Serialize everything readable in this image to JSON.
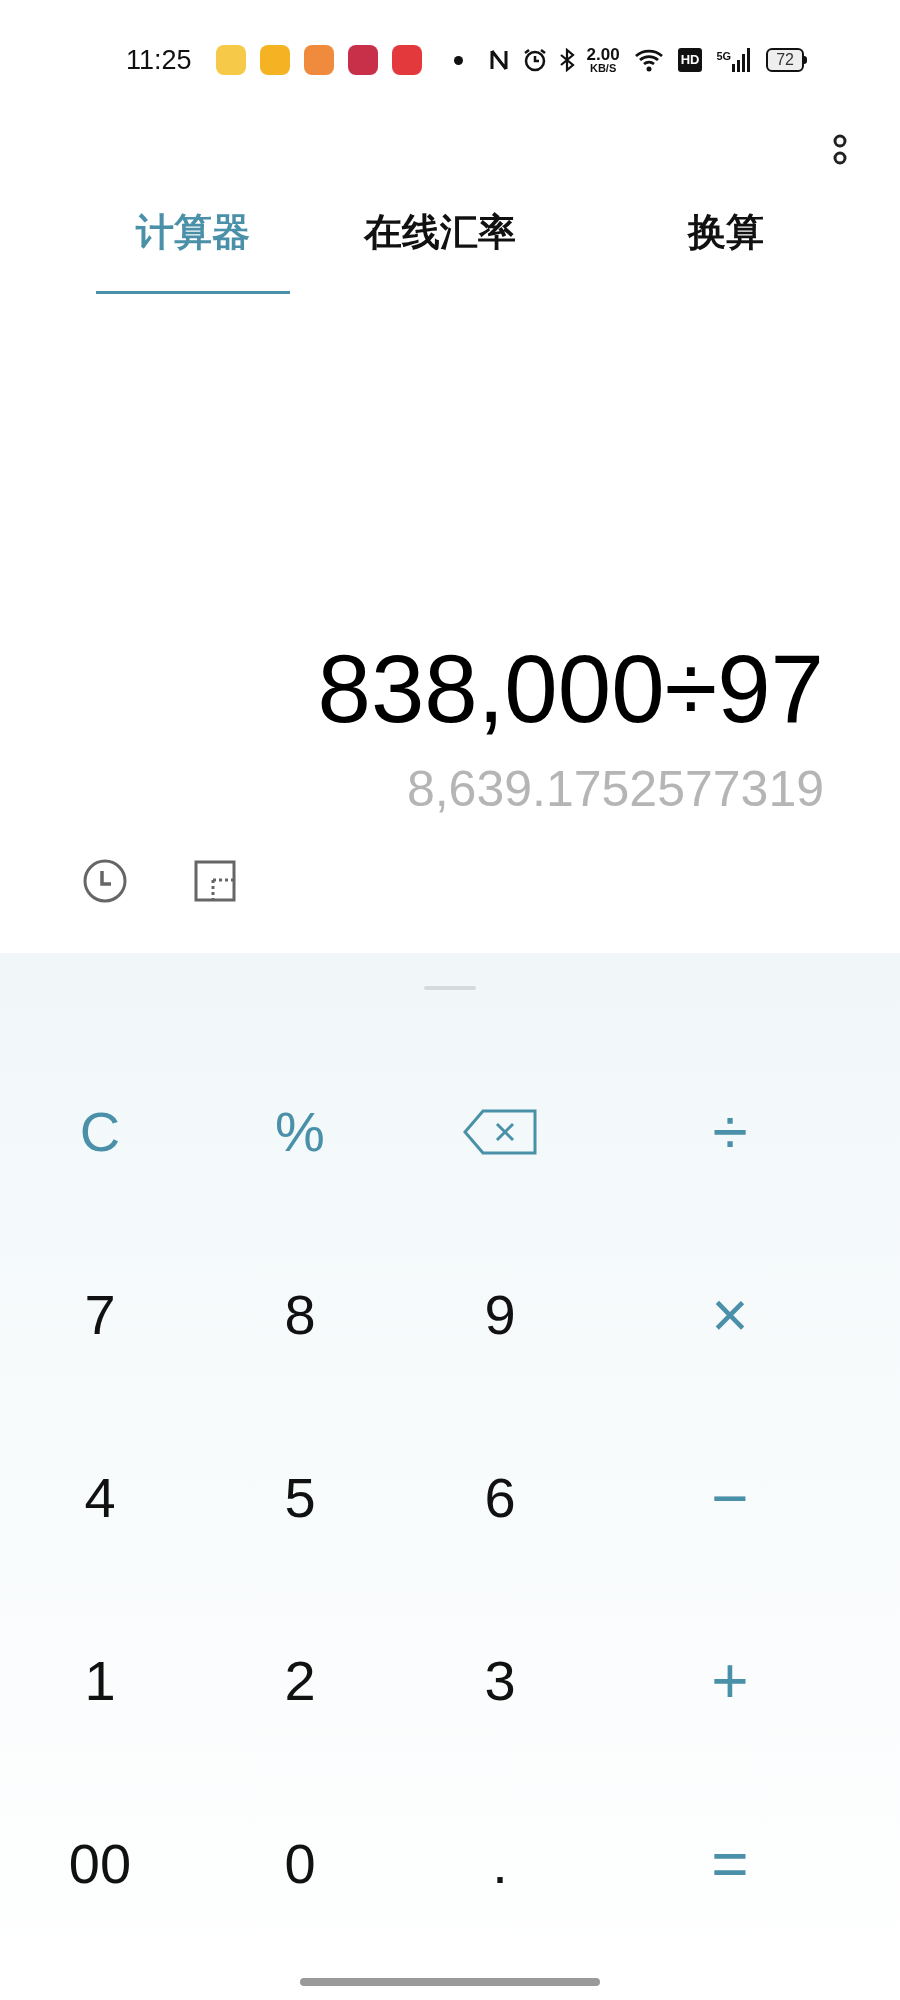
{
  "status_bar": {
    "time": "11:25",
    "speed_value": "2.00",
    "speed_unit": "KB/S",
    "hd": "HD",
    "network": "5G",
    "battery": "72"
  },
  "tabs": [
    {
      "label": "计算器",
      "selected": true
    },
    {
      "label": "在线汇率",
      "selected": false
    },
    {
      "label": "换算",
      "selected": false
    }
  ],
  "display": {
    "expression": "838,000÷97",
    "result": "8,639.1752577319"
  },
  "keypad": [
    [
      {
        "kind": "clear",
        "label": "C"
      },
      {
        "kind": "operator",
        "label": "%"
      },
      {
        "kind": "backspace"
      },
      {
        "kind": "operator",
        "label": "÷"
      }
    ],
    [
      {
        "kind": "digit",
        "label": "7"
      },
      {
        "kind": "digit",
        "label": "8"
      },
      {
        "kind": "digit",
        "label": "9"
      },
      {
        "kind": "operator",
        "label": "×"
      }
    ],
    [
      {
        "kind": "digit",
        "label": "4"
      },
      {
        "kind": "digit",
        "label": "5"
      },
      {
        "kind": "digit",
        "label": "6"
      },
      {
        "kind": "operator",
        "label": "−"
      }
    ],
    [
      {
        "kind": "digit",
        "label": "1"
      },
      {
        "kind": "digit",
        "label": "2"
      },
      {
        "kind": "digit",
        "label": "3"
      },
      {
        "kind": "operator",
        "label": "+"
      }
    ],
    [
      {
        "kind": "digit",
        "label": "00"
      },
      {
        "kind": "digit",
        "label": "0"
      },
      {
        "kind": "digit",
        "label": "."
      },
      {
        "kind": "operator",
        "label": "="
      }
    ]
  ]
}
